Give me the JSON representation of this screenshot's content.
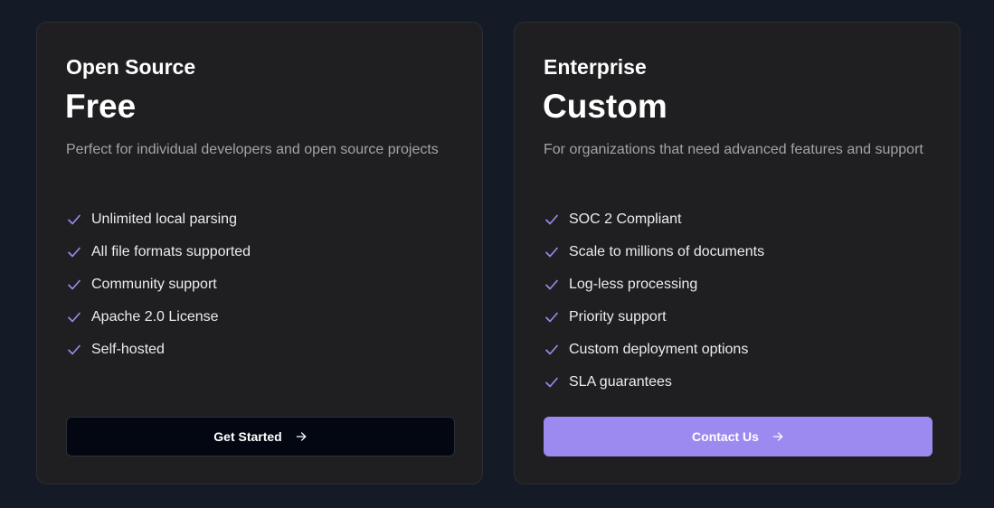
{
  "colors": {
    "page_background": "#151a27",
    "card_background": "#1f1f21",
    "check_accent": "#9d8af0",
    "primary_button": "#9d8af0",
    "dark_button": "#030711"
  },
  "plans": [
    {
      "name": "Open Source",
      "price": "Free",
      "description": "Perfect for individual developers and open source projects",
      "features": [
        "Unlimited local parsing",
        "All file formats supported",
        "Community support",
        "Apache 2.0 License",
        "Self-hosted"
      ],
      "cta": {
        "label": "Get Started",
        "icon": "arrow-right-icon"
      }
    },
    {
      "name": "Enterprise",
      "price": "Custom",
      "description": "For organizations that need advanced features and support",
      "features": [
        "SOC 2 Compliant",
        "Scale to millions of documents",
        "Log-less processing",
        "Priority support",
        "Custom deployment options",
        "SLA guarantees"
      ],
      "cta": {
        "label": "Contact Us",
        "icon": "arrow-right-icon"
      }
    }
  ],
  "icons": {
    "feature": "check-icon"
  }
}
